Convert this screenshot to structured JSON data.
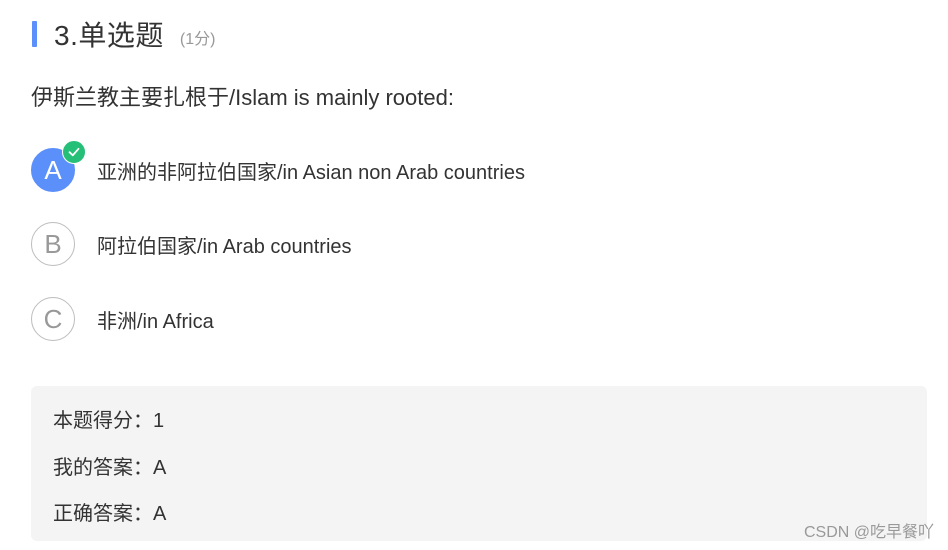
{
  "question": {
    "title": "3.单选题",
    "score": "(1分)",
    "stem": "伊斯兰教主要扎根于/Islam is mainly rooted:"
  },
  "options": [
    {
      "letter": "A",
      "text": "亚洲的非阿拉伯国家/in Asian non Arab countries",
      "selected": true
    },
    {
      "letter": "B",
      "text": "阿拉伯国家/in Arab countries",
      "selected": false
    },
    {
      "letter": "C",
      "text": "非洲/in Africa",
      "selected": false
    }
  ],
  "result": {
    "score_line": "本题得分：1",
    "my_answer_line": "我的答案：A",
    "correct_answer_line": "正确答案：A"
  },
  "watermark": "CSDN @吃早餐吖",
  "colors": {
    "accent": "#5b8ff9",
    "check": "#25bf78",
    "result_bg": "#f4f4f4"
  },
  "icons": {
    "title_marker": "vertical-bar",
    "selected_mark": "check-icon"
  }
}
